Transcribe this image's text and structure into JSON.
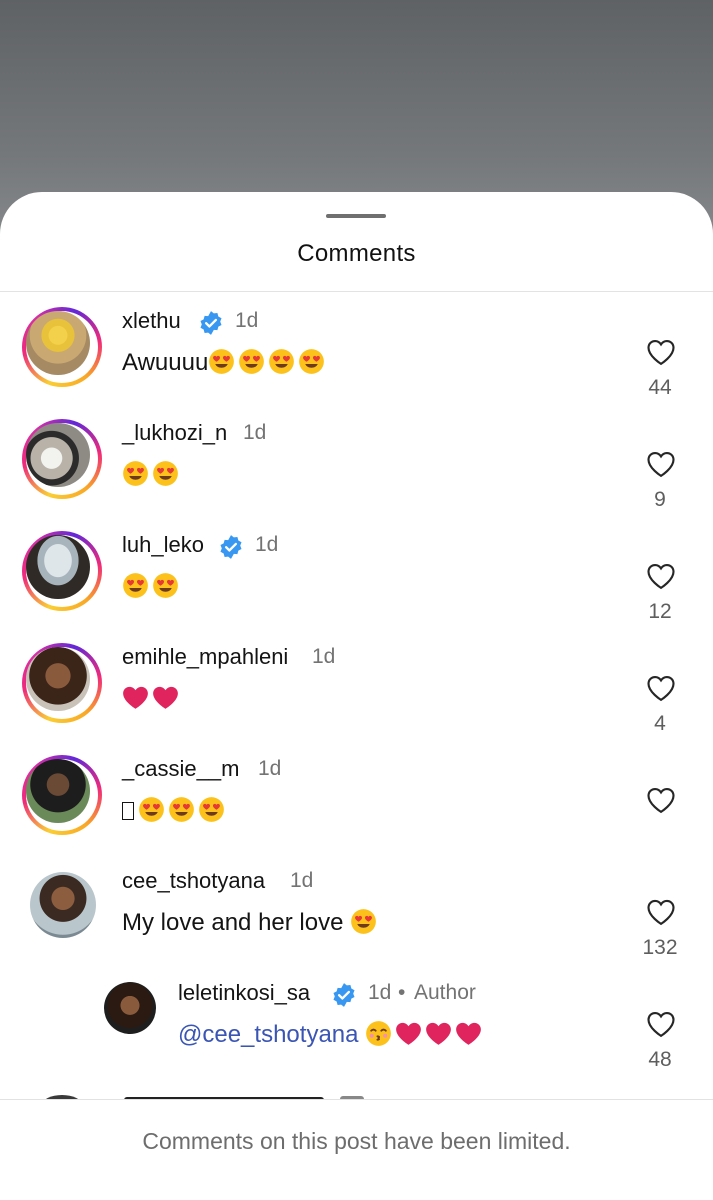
{
  "sheet": {
    "title": "Comments"
  },
  "comments": [
    {
      "username": "xlethu",
      "verified": true,
      "time": "1d",
      "text": "Awuuuu",
      "emojis": [
        "heart-eyes",
        "heart-eyes",
        "heart-eyes",
        "heart-eyes"
      ],
      "likes": "44",
      "story_ring": true
    },
    {
      "username": "_lukhozi_n",
      "verified": false,
      "time": "1d",
      "text": "",
      "emojis": [
        "heart-eyes",
        "heart-eyes"
      ],
      "likes": "9",
      "story_ring": true
    },
    {
      "username": "luh_leko",
      "verified": true,
      "time": "1d",
      "text": "",
      "emojis": [
        "heart-eyes",
        "heart-eyes"
      ],
      "likes": "12",
      "story_ring": true
    },
    {
      "username": "emihle_mpahleni",
      "verified": false,
      "time": "1d",
      "text": "",
      "emojis": [
        "red-heart",
        "red-heart"
      ],
      "likes": "4",
      "story_ring": true
    },
    {
      "username": "_cassie__m",
      "verified": false,
      "time": "1d",
      "text": "",
      "emojis": [
        "missing-glyph",
        "heart-eyes",
        "heart-eyes",
        "heart-eyes"
      ],
      "likes": "",
      "story_ring": true
    },
    {
      "username": "cee_tshotyana",
      "verified": false,
      "time": "1d",
      "text": "My love and her love ",
      "emojis": [
        "heart-eyes"
      ],
      "likes": "132",
      "story_ring": false
    }
  ],
  "reply": {
    "username": "leletinkosi_sa",
    "verified": true,
    "time": "1d",
    "separator": "•",
    "author_tag": "Author",
    "mention": "@cee_tshotyana",
    "emojis": [
      "kissing-face",
      "red-heart",
      "red-heart",
      "red-heart"
    ],
    "likes": "48"
  },
  "footer": {
    "text": "Comments on this post have been limited."
  },
  "colors": {
    "verified_blue": "#3897f0",
    "mention_blue": "#3a55b4",
    "heart_red": "#e0245e"
  }
}
